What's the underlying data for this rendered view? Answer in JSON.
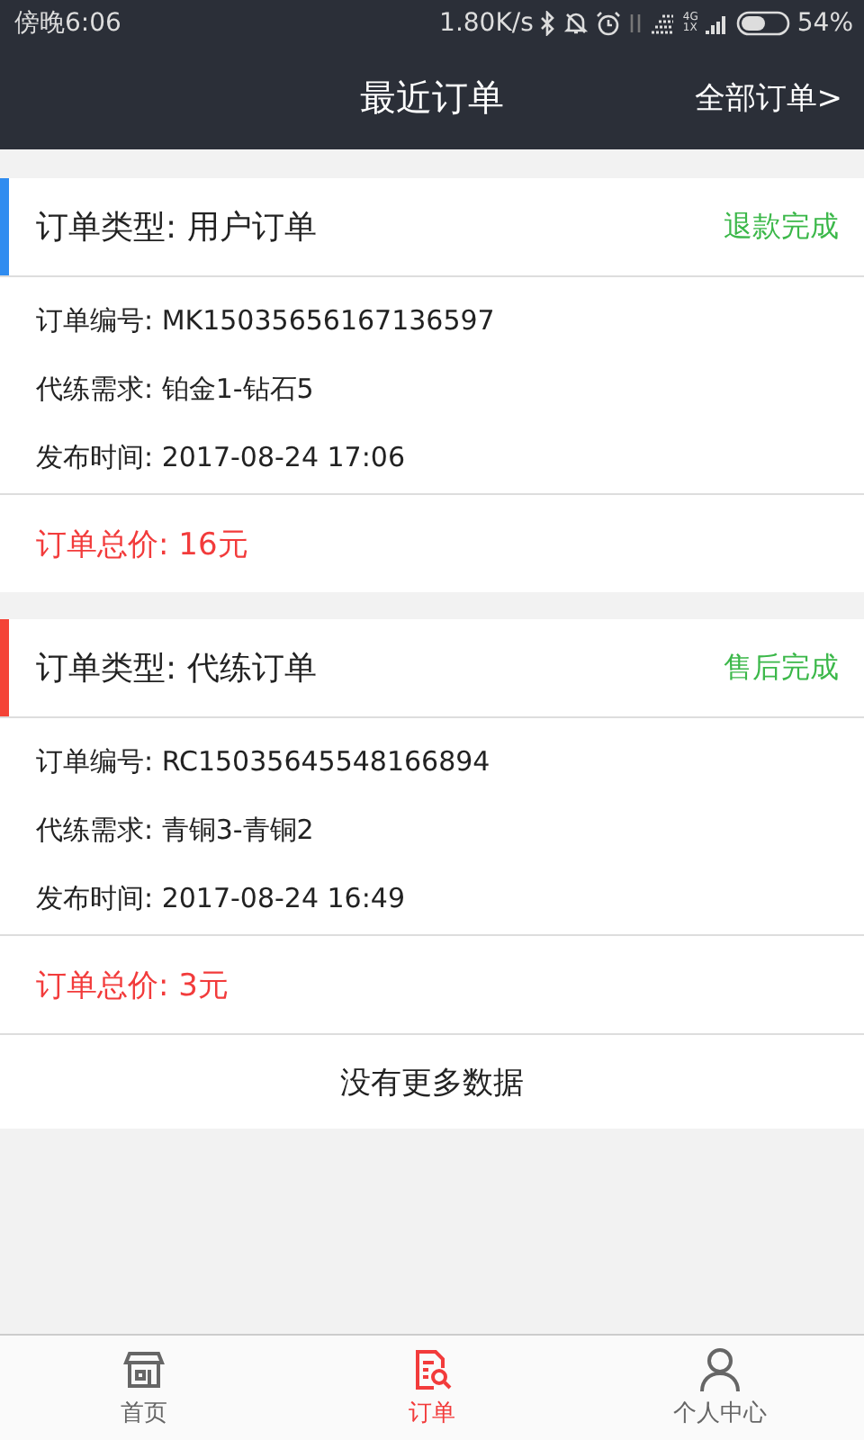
{
  "status_bar": {
    "time": "傍晚6:06",
    "speed": "1.80K/s",
    "network_top": "4G",
    "network_bottom": "1X",
    "battery": "54%"
  },
  "header": {
    "title": "最近订单",
    "action": "全部订单>"
  },
  "orders": [
    {
      "type_label": "订单类型: 用户订单",
      "status": "退款完成",
      "color": "#2f8cf0",
      "details": [
        "订单编号: MK15035656167136597",
        "代练需求: 铂金1-钻石5",
        "发布时间: 2017-08-24 17:06"
      ],
      "total": "订单总价: 16元"
    },
    {
      "type_label": "订单类型: 代练订单",
      "status": "售后完成",
      "color": "#f44336",
      "details": [
        "订单编号: RC15035645548166894",
        "代练需求: 青铜3-青铜2",
        "发布时间: 2017-08-24 16:49"
      ],
      "total": "订单总价: 3元"
    }
  ],
  "footer_note": "没有更多数据",
  "tabs": [
    {
      "label": "首页",
      "kind": "home",
      "selected": false
    },
    {
      "label": "订单",
      "kind": "orders",
      "selected": true
    },
    {
      "label": "个人中心",
      "kind": "profile",
      "selected": false
    }
  ]
}
